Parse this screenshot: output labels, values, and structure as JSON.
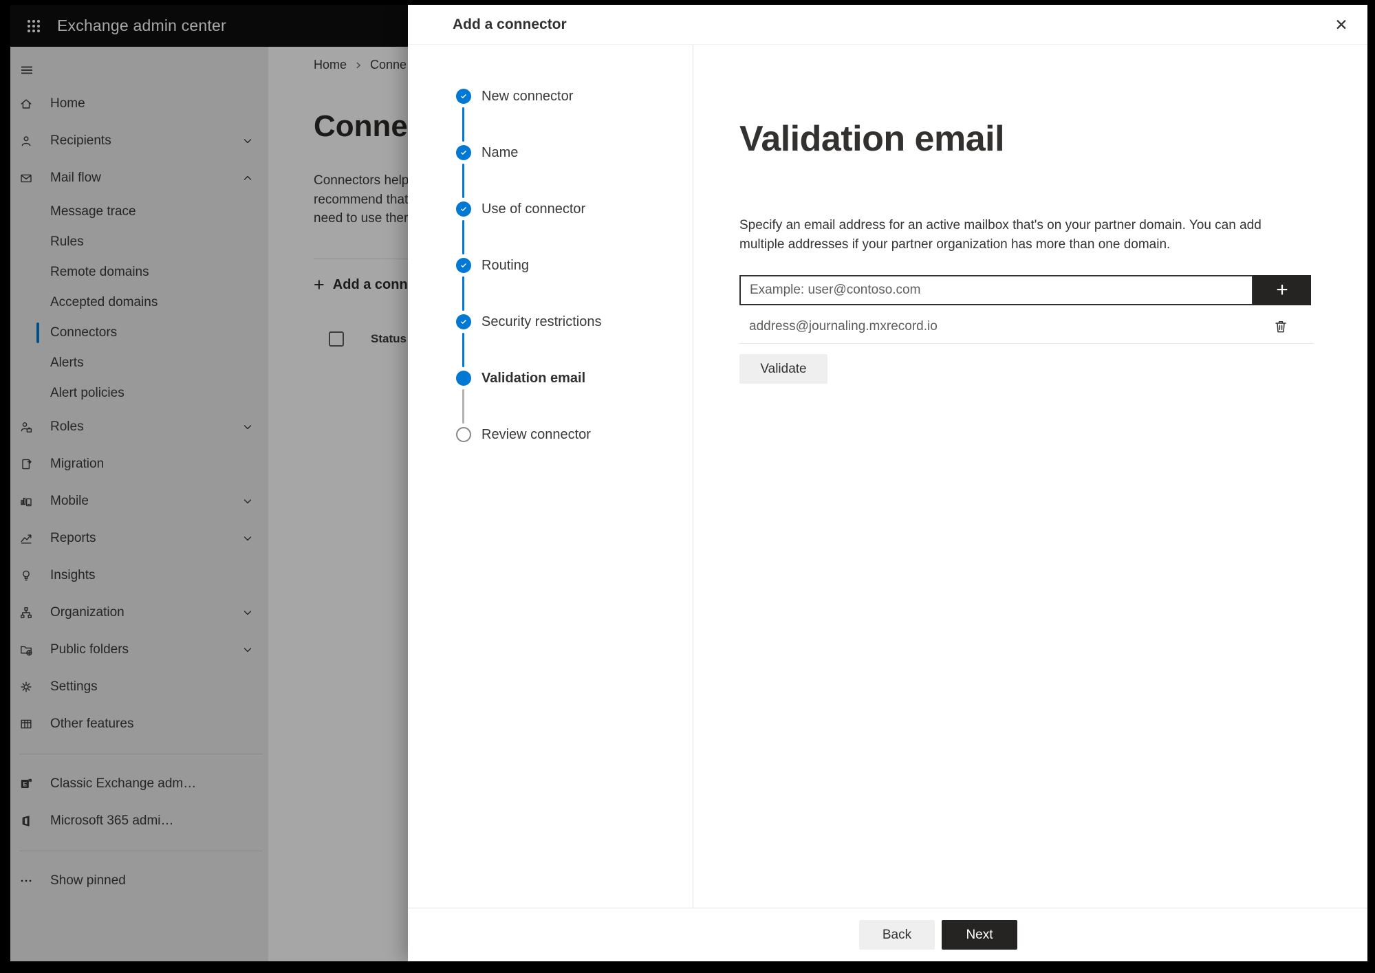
{
  "colors": {
    "accent": "#0078d4",
    "topbar_bg": "#0f0f0f",
    "dark_button_bg": "#252423",
    "light_button_bg": "#efefef",
    "dim_overlay": "rgba(0,0,0,0.35)"
  },
  "topbar": {
    "title": "Exchange admin center"
  },
  "sidebar": {
    "items": [
      {
        "label": "Home",
        "icon": "home"
      },
      {
        "label": "Recipients",
        "icon": "person",
        "chevron": "down"
      },
      {
        "label": "Mail flow",
        "icon": "mail",
        "chevron": "up"
      },
      {
        "label": "Message trace",
        "sub": true
      },
      {
        "label": "Rules",
        "sub": true
      },
      {
        "label": "Remote domains",
        "sub": true
      },
      {
        "label": "Accepted domains",
        "sub": true
      },
      {
        "label": "Connectors",
        "sub": true,
        "selected": true
      },
      {
        "label": "Alerts",
        "sub": true
      },
      {
        "label": "Alert policies",
        "sub": true
      },
      {
        "label": "Roles",
        "icon": "person-badge",
        "chevron": "down"
      },
      {
        "label": "Migration",
        "icon": "migration"
      },
      {
        "label": "Mobile",
        "icon": "mobile",
        "chevron": "down"
      },
      {
        "label": "Reports",
        "icon": "report",
        "chevron": "down"
      },
      {
        "label": "Insights",
        "icon": "bulb"
      },
      {
        "label": "Organization",
        "icon": "org",
        "chevron": "down"
      },
      {
        "label": "Public folders",
        "icon": "folder-globe",
        "chevron": "down"
      },
      {
        "label": "Settings",
        "icon": "gear"
      },
      {
        "label": "Other features",
        "icon": "grid"
      },
      {
        "divider": true
      },
      {
        "label": "Classic Exchange adm…",
        "icon": "exchange"
      },
      {
        "label": "Microsoft 365 admi…",
        "icon": "office"
      },
      {
        "divider": true
      },
      {
        "label": "Show pinned",
        "icon": "dots"
      }
    ]
  },
  "page": {
    "breadcrumb": {
      "home": "Home",
      "current": "Conne"
    },
    "title": "Connect",
    "intro_lines": [
      "Connectors help",
      "recommend that",
      "need to use ther"
    ],
    "add_button": "Add a conn",
    "status_header": "Status"
  },
  "modal": {
    "title": "Add a connector",
    "close_icon": "✕",
    "steps": [
      {
        "label": "New connector",
        "state": "done"
      },
      {
        "label": "Name",
        "state": "done"
      },
      {
        "label": "Use of connector",
        "state": "done"
      },
      {
        "label": "Routing",
        "state": "done"
      },
      {
        "label": "Security restrictions",
        "state": "done"
      },
      {
        "label": "Validation email",
        "state": "current"
      },
      {
        "label": "Review connector",
        "state": "todo"
      }
    ],
    "content": {
      "heading": "Validation email",
      "description_line1": "Specify an email address for an active mailbox that's on your partner domain. You can add",
      "description_line2": "multiple addresses if your partner organization has more than one domain.",
      "email_placeholder": "Example: user@contoso.com",
      "add_email_label": "+",
      "address": "address@journaling.mxrecord.io",
      "validate_label": "Validate"
    },
    "footer": {
      "back_label": "Back",
      "next_label": "Next"
    }
  }
}
